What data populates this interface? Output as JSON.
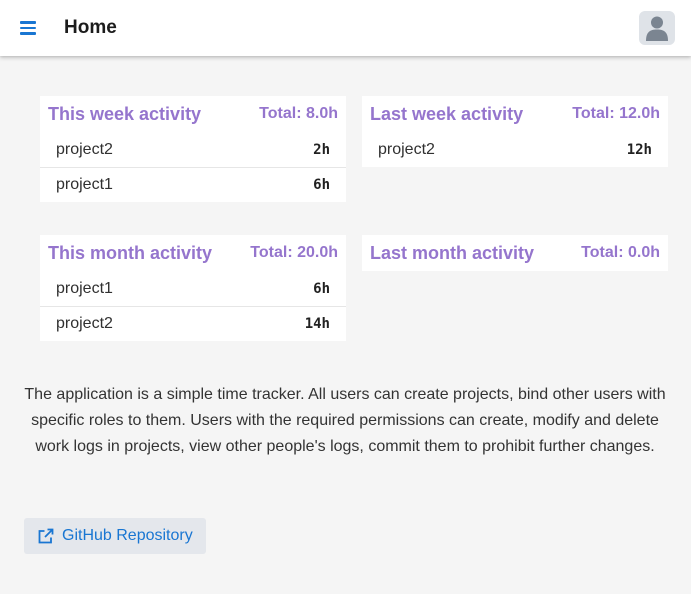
{
  "header": {
    "title": "Home",
    "menu_icon": "menu-icon",
    "avatar_icon": "user-avatar-icon"
  },
  "colors": {
    "accent": "#1976d2",
    "card_heading": "#9575cd",
    "background": "#f5f5f5"
  },
  "cards": [
    {
      "title": "This week activity",
      "total": "Total: 8.0h",
      "rows": [
        {
          "project": "project2",
          "hours": "2h"
        },
        {
          "project": "project1",
          "hours": "6h"
        }
      ]
    },
    {
      "title": "Last week activity",
      "total": "Total: 12.0h",
      "rows": [
        {
          "project": "project2",
          "hours": "12h"
        }
      ]
    },
    {
      "title": "This month activity",
      "total": "Total: 20.0h",
      "rows": [
        {
          "project": "project1",
          "hours": "6h"
        },
        {
          "project": "project2",
          "hours": "14h"
        }
      ]
    },
    {
      "title": "Last month activity",
      "total": "Total: 0.0h",
      "rows": []
    }
  ],
  "description": "The application is a simple time tracker. All users can create projects, bind other users with specific roles to them. Users with the required permissions can create, modify and delete work logs in projects, view other people's logs, commit them to prohibit further changes.",
  "github_button": {
    "label": "GitHub Repository",
    "icon": "external-link-icon"
  }
}
